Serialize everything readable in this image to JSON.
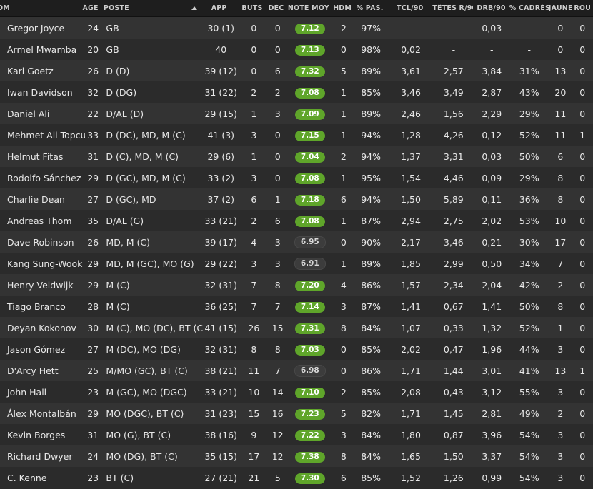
{
  "columns": {
    "nom": "OM",
    "age": "ÂGE",
    "poste": "POSTE",
    "app": "APP",
    "buts": "BUTS",
    "dec": "DÉC",
    "note": "NOTE MOY",
    "hdm": "HDM",
    "pas": "% PAS.",
    "tcl": "TCL/90",
    "tetes": "TÊTES R/90",
    "drb": "DRB/90",
    "cadres": "% CADRÉS",
    "jaune": "JAUNE",
    "rou": "ROU"
  },
  "colors": {
    "rating_good": "#5fa52a",
    "rating_neutral": "#3c3c3c"
  },
  "players": [
    {
      "name": "Gregor Joyce",
      "age": "24",
      "poste": "GB",
      "app": "30 (1)",
      "buts": "0",
      "dec": "0",
      "note": "7.12",
      "rating": "good",
      "hdm": "2",
      "pas": "97%",
      "tcl": "-",
      "tetes": "-",
      "drb": "0,03",
      "cadres": "-",
      "jaune": "0",
      "rou": "0"
    },
    {
      "name": "Armel Mwamba",
      "age": "20",
      "poste": "GB",
      "app": "40",
      "buts": "0",
      "dec": "0",
      "note": "7.13",
      "rating": "good",
      "hdm": "0",
      "pas": "98%",
      "tcl": "0,02",
      "tetes": "-",
      "drb": "-",
      "cadres": "-",
      "jaune": "0",
      "rou": "0"
    },
    {
      "name": "Karl Goetz",
      "age": "26",
      "poste": "D (D)",
      "app": "39 (12)",
      "buts": "0",
      "dec": "6",
      "note": "7.32",
      "rating": "good",
      "hdm": "5",
      "pas": "89%",
      "tcl": "3,61",
      "tetes": "2,57",
      "drb": "3,84",
      "cadres": "31%",
      "jaune": "13",
      "rou": "0"
    },
    {
      "name": "Iwan Davidson",
      "age": "32",
      "poste": "D (DG)",
      "app": "31 (22)",
      "buts": "2",
      "dec": "2",
      "note": "7.08",
      "rating": "good",
      "hdm": "1",
      "pas": "85%",
      "tcl": "3,46",
      "tetes": "3,49",
      "drb": "2,87",
      "cadres": "43%",
      "jaune": "20",
      "rou": "0"
    },
    {
      "name": "Daniel Ali",
      "age": "22",
      "poste": "D/AL (D)",
      "app": "29 (15)",
      "buts": "1",
      "dec": "3",
      "note": "7.09",
      "rating": "good",
      "hdm": "1",
      "pas": "89%",
      "tcl": "2,46",
      "tetes": "1,56",
      "drb": "2,29",
      "cadres": "29%",
      "jaune": "11",
      "rou": "0"
    },
    {
      "name": "Mehmet Ali Topcu",
      "age": "33",
      "poste": "D (DC), MD, M (C)",
      "app": "41 (3)",
      "buts": "3",
      "dec": "0",
      "note": "7.15",
      "rating": "good",
      "hdm": "1",
      "pas": "94%",
      "tcl": "1,28",
      "tetes": "4,26",
      "drb": "0,12",
      "cadres": "52%",
      "jaune": "11",
      "rou": "1"
    },
    {
      "name": "Helmut Fitas",
      "age": "31",
      "poste": "D (C), MD, M (C)",
      "app": "29 (6)",
      "buts": "1",
      "dec": "0",
      "note": "7.04",
      "rating": "good",
      "hdm": "2",
      "pas": "94%",
      "tcl": "1,37",
      "tetes": "3,31",
      "drb": "0,03",
      "cadres": "50%",
      "jaune": "6",
      "rou": "0"
    },
    {
      "name": "Rodolfo Sánchez",
      "age": "29",
      "poste": "D (GC), MD, M (C)",
      "app": "33 (2)",
      "buts": "3",
      "dec": "0",
      "note": "7.08",
      "rating": "good",
      "hdm": "1",
      "pas": "95%",
      "tcl": "1,54",
      "tetes": "4,46",
      "drb": "0,09",
      "cadres": "29%",
      "jaune": "8",
      "rou": "0"
    },
    {
      "name": "Charlie Dean",
      "age": "27",
      "poste": "D (GC), MD",
      "app": "37 (2)",
      "buts": "6",
      "dec": "1",
      "note": "7.18",
      "rating": "good",
      "hdm": "6",
      "pas": "94%",
      "tcl": "1,50",
      "tetes": "5,89",
      "drb": "0,11",
      "cadres": "36%",
      "jaune": "8",
      "rou": "0"
    },
    {
      "name": "Andreas Thom",
      "age": "35",
      "poste": "D/AL (G)",
      "app": "33 (21)",
      "buts": "2",
      "dec": "6",
      "note": "7.08",
      "rating": "good",
      "hdm": "1",
      "pas": "87%",
      "tcl": "2,94",
      "tetes": "2,75",
      "drb": "2,02",
      "cadres": "53%",
      "jaune": "10",
      "rou": "0"
    },
    {
      "name": "Dave Robinson",
      "age": "26",
      "poste": "MD, M (C)",
      "app": "39 (17)",
      "buts": "4",
      "dec": "3",
      "note": "6.95",
      "rating": "neutral",
      "hdm": "0",
      "pas": "90%",
      "tcl": "2,17",
      "tetes": "3,46",
      "drb": "0,21",
      "cadres": "30%",
      "jaune": "17",
      "rou": "0"
    },
    {
      "name": "Kang Sung-Wook",
      "age": "29",
      "poste": "MD, M (GC), MO (G)",
      "app": "29 (22)",
      "buts": "3",
      "dec": "3",
      "note": "6.91",
      "rating": "neutral",
      "hdm": "1",
      "pas": "89%",
      "tcl": "1,85",
      "tetes": "2,99",
      "drb": "0,50",
      "cadres": "34%",
      "jaune": "7",
      "rou": "0"
    },
    {
      "name": "Henry Veldwijk",
      "age": "29",
      "poste": "M (C)",
      "app": "32 (31)",
      "buts": "7",
      "dec": "8",
      "note": "7.20",
      "rating": "good",
      "hdm": "4",
      "pas": "86%",
      "tcl": "1,57",
      "tetes": "2,34",
      "drb": "2,04",
      "cadres": "42%",
      "jaune": "2",
      "rou": "0"
    },
    {
      "name": "Tiago Branco",
      "age": "28",
      "poste": "M (C)",
      "app": "36 (25)",
      "buts": "7",
      "dec": "7",
      "note": "7.14",
      "rating": "good",
      "hdm": "3",
      "pas": "87%",
      "tcl": "1,41",
      "tetes": "0,67",
      "drb": "1,41",
      "cadres": "50%",
      "jaune": "8",
      "rou": "0"
    },
    {
      "name": "Deyan Kokonov",
      "age": "30",
      "poste": "M (C), MO (DC), BT (C)",
      "app": "41 (15)",
      "buts": "26",
      "dec": "15",
      "note": "7.31",
      "rating": "good",
      "hdm": "8",
      "pas": "84%",
      "tcl": "1,07",
      "tetes": "0,33",
      "drb": "1,32",
      "cadres": "52%",
      "jaune": "1",
      "rou": "0"
    },
    {
      "name": "Jason Gómez",
      "age": "27",
      "poste": "M (DC), MO (DG)",
      "app": "32 (31)",
      "buts": "8",
      "dec": "8",
      "note": "7.03",
      "rating": "good",
      "hdm": "0",
      "pas": "85%",
      "tcl": "2,02",
      "tetes": "0,47",
      "drb": "1,96",
      "cadres": "44%",
      "jaune": "3",
      "rou": "0"
    },
    {
      "name": "D'Arcy Hett",
      "age": "25",
      "poste": "M/MO (GC), BT (C)",
      "app": "38 (21)",
      "buts": "11",
      "dec": "7",
      "note": "6.98",
      "rating": "neutral",
      "hdm": "0",
      "pas": "86%",
      "tcl": "1,71",
      "tetes": "1,44",
      "drb": "3,01",
      "cadres": "41%",
      "jaune": "13",
      "rou": "1"
    },
    {
      "name": "John Hall",
      "age": "23",
      "poste": "M (GC), MO (DGC)",
      "app": "33 (21)",
      "buts": "10",
      "dec": "14",
      "note": "7.10",
      "rating": "good",
      "hdm": "2",
      "pas": "85%",
      "tcl": "2,08",
      "tetes": "0,43",
      "drb": "3,12",
      "cadres": "55%",
      "jaune": "3",
      "rou": "0"
    },
    {
      "name": "Álex Montalbán",
      "age": "29",
      "poste": "MO (DGC), BT (C)",
      "app": "31 (23)",
      "buts": "15",
      "dec": "16",
      "note": "7.23",
      "rating": "good",
      "hdm": "5",
      "pas": "82%",
      "tcl": "1,71",
      "tetes": "1,45",
      "drb": "2,81",
      "cadres": "49%",
      "jaune": "2",
      "rou": "0"
    },
    {
      "name": "Kevin Borges",
      "age": "31",
      "poste": "MO (G), BT (C)",
      "app": "38 (16)",
      "buts": "9",
      "dec": "12",
      "note": "7.22",
      "rating": "good",
      "hdm": "3",
      "pas": "84%",
      "tcl": "1,80",
      "tetes": "0,87",
      "drb": "3,96",
      "cadres": "54%",
      "jaune": "3",
      "rou": "0"
    },
    {
      "name": "Richard Dwyer",
      "age": "24",
      "poste": "MO (DG), BT (C)",
      "app": "35 (15)",
      "buts": "17",
      "dec": "12",
      "note": "7.38",
      "rating": "good",
      "hdm": "8",
      "pas": "84%",
      "tcl": "1,65",
      "tetes": "1,50",
      "drb": "3,37",
      "cadres": "54%",
      "jaune": "3",
      "rou": "0"
    },
    {
      "name": "C. Kenne",
      "age": "23",
      "poste": "BT (C)",
      "app": "27 (21)",
      "buts": "21",
      "dec": "5",
      "note": "7.30",
      "rating": "good",
      "hdm": "6",
      "pas": "85%",
      "tcl": "1,52",
      "tetes": "1,26",
      "drb": "0,99",
      "cadres": "54%",
      "jaune": "3",
      "rou": "0"
    }
  ]
}
